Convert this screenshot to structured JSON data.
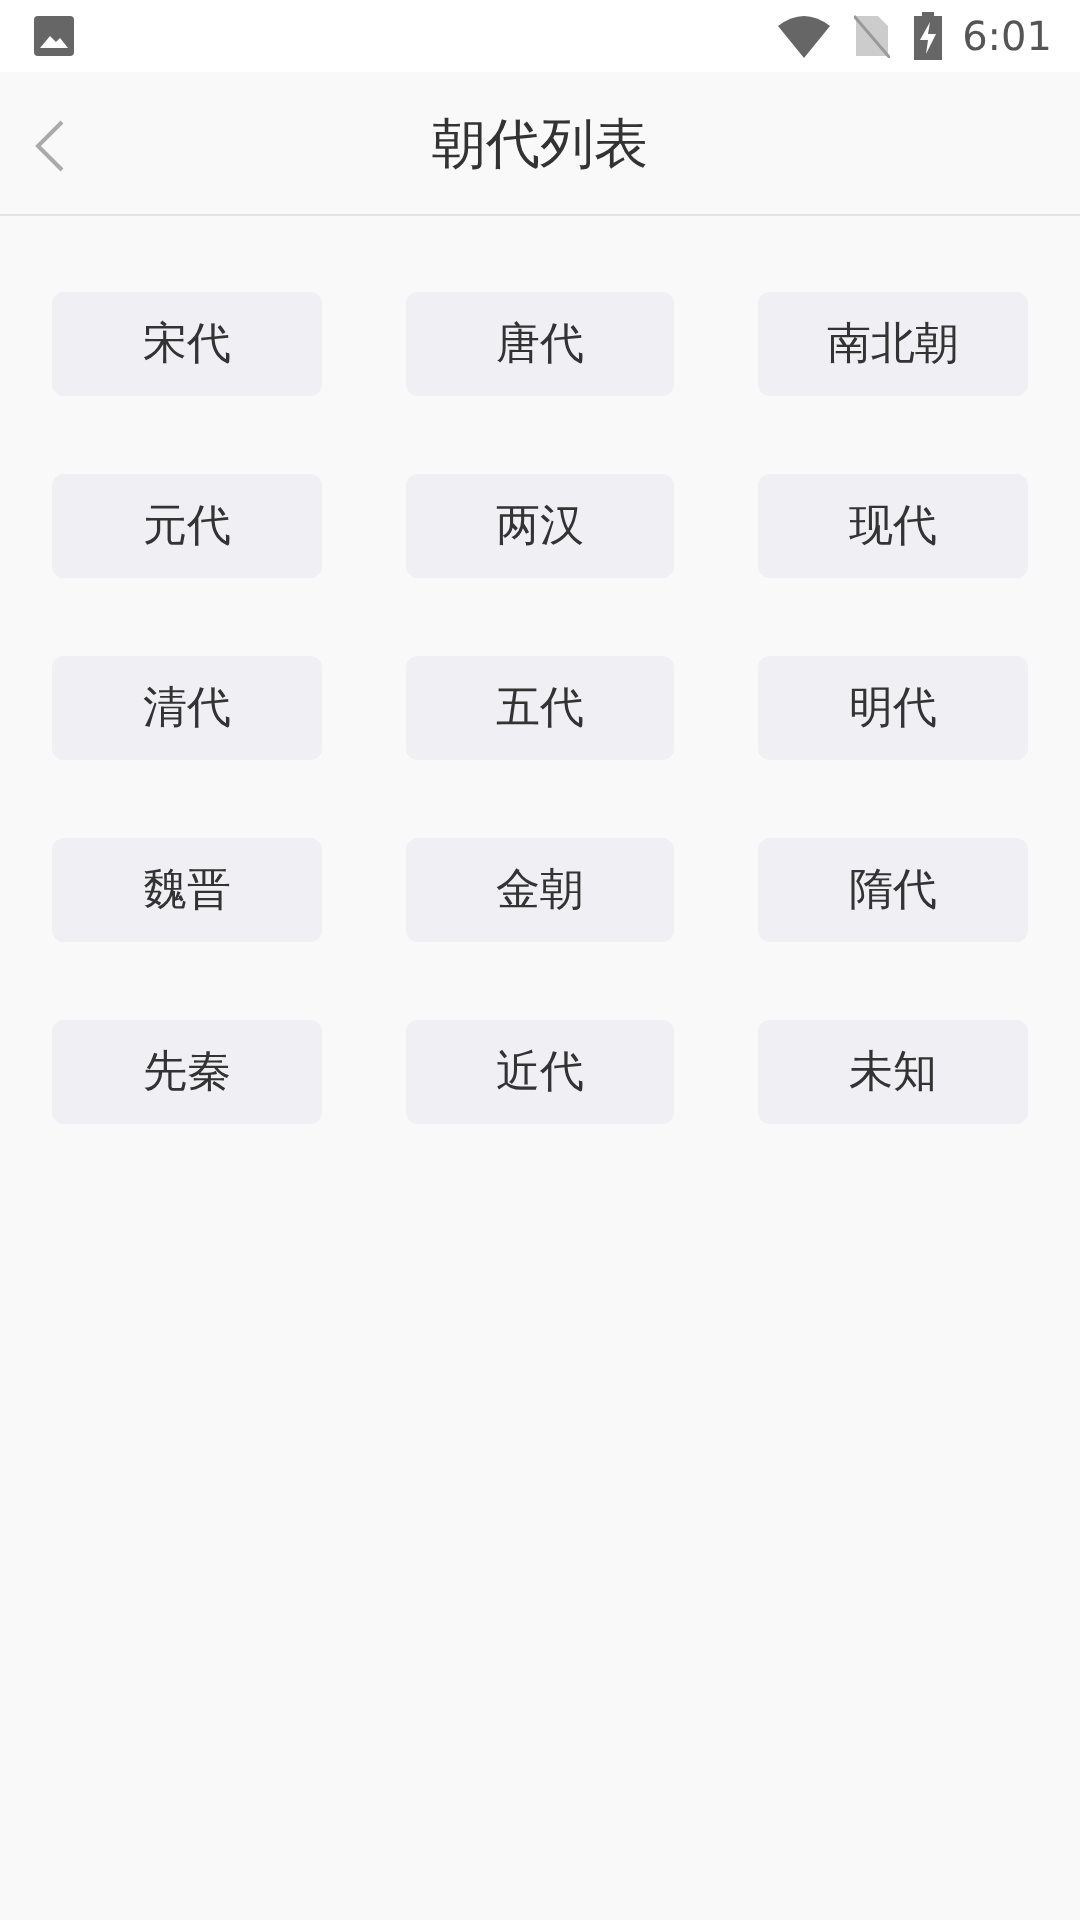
{
  "status_bar": {
    "time": "6:01"
  },
  "header": {
    "title": "朝代列表"
  },
  "dynasties": [
    "宋代",
    "唐代",
    "南北朝",
    "元代",
    "两汉",
    "现代",
    "清代",
    "五代",
    "明代",
    "魏晋",
    "金朝",
    "隋代",
    "先秦",
    "近代",
    "未知"
  ]
}
